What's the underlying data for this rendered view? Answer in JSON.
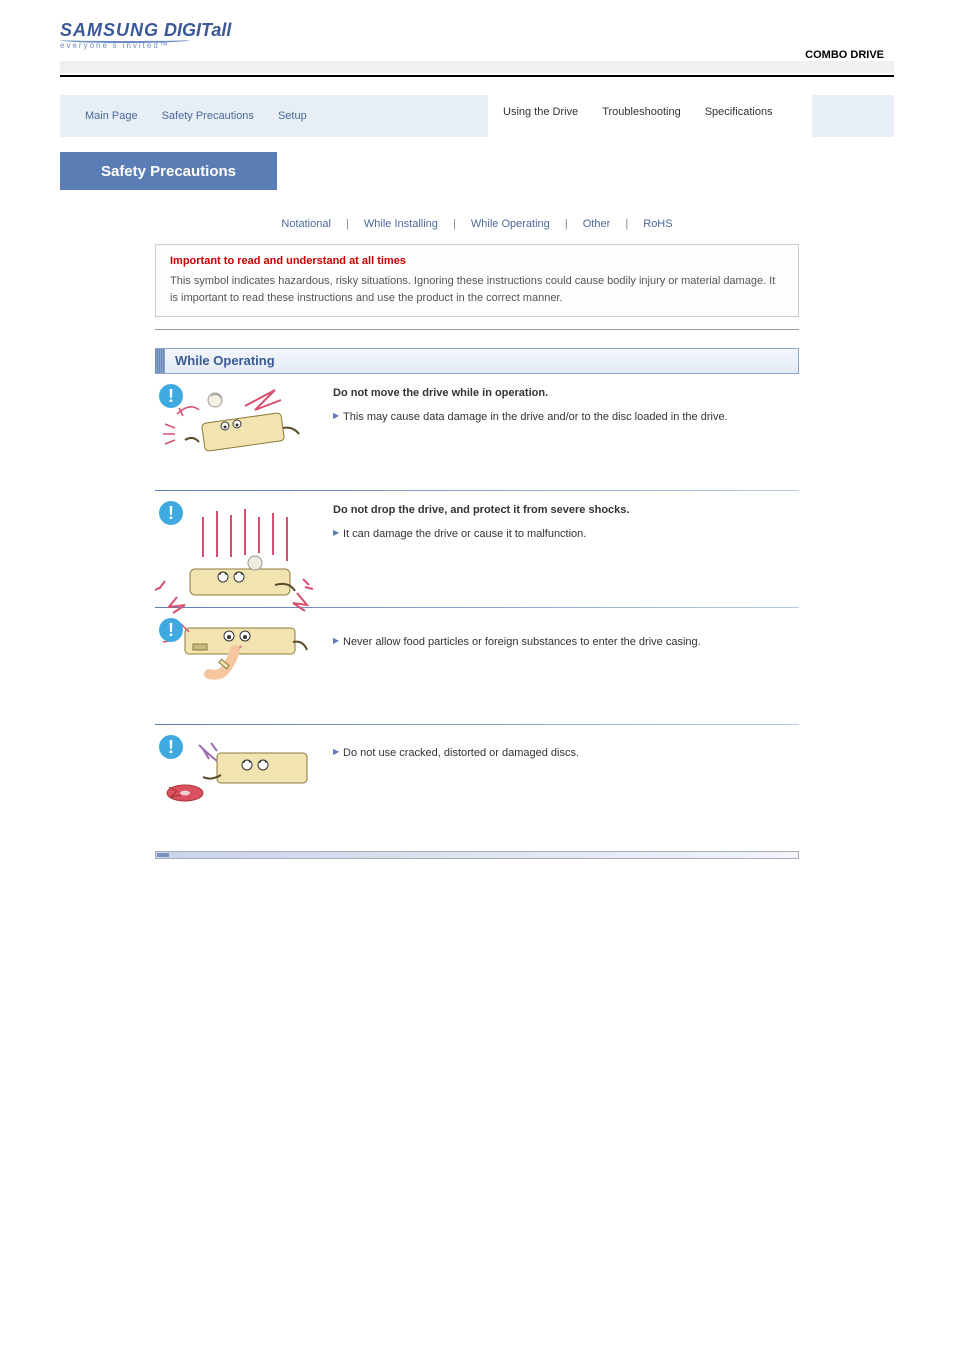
{
  "logo": {
    "brand_primary": "SAMSUNG",
    "brand_secondary": "DIGITall",
    "tagline": "everyone's invited™"
  },
  "model": "COMBO DRIVE",
  "top_nav": {
    "items": [
      "Main Page",
      "Safety Precautions",
      "Setup",
      "Using the Drive",
      "Troubleshooting",
      "Specifications"
    ]
  },
  "section_badge": "Safety Precautions",
  "sub_nav": {
    "items": [
      "Notational",
      "While Installing",
      "While Operating",
      "Other",
      "RoHS"
    ]
  },
  "important": {
    "title": "Important to read and understand at all times",
    "text": "This symbol indicates hazardous, risky situations. Ignoring these instructions could cause bodily injury or material damage. It is important to read these instructions and use the product in the correct manner."
  },
  "op_header": "While Operating",
  "warnings": [
    {
      "icon_name": "exclamation-icon",
      "heading": "Do not move the drive while in operation.",
      "bullet": "This may cause data damage in the drive and/or to the disc loaded in the drive."
    },
    {
      "icon_name": "exclamation-icon",
      "heading": "Do not drop the drive, and protect it from severe shocks.",
      "bullet": "It can damage the drive or cause it to malfunction."
    },
    {
      "icon_name": "exclamation-icon",
      "heading": "",
      "bullet": "Never allow food particles or foreign substances to enter the drive casing."
    },
    {
      "icon_name": "exclamation-icon",
      "heading": "",
      "bullet": "Do not use cracked, distorted or damaged discs."
    }
  ]
}
